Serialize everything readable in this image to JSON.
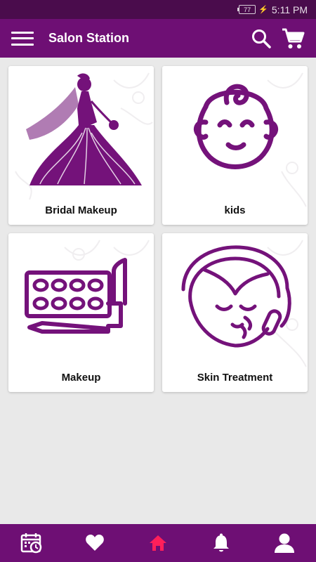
{
  "status_bar": {
    "battery": "77",
    "time": "5:11 PM"
  },
  "app_bar": {
    "title": "Salon Station"
  },
  "categories": [
    {
      "label": "Bridal Makeup",
      "icon": "bride-icon"
    },
    {
      "label": "kids",
      "icon": "baby-face-icon"
    },
    {
      "label": "Makeup",
      "icon": "makeup-kit-icon"
    },
    {
      "label": "Skin Treatment",
      "icon": "facial-treatment-icon"
    }
  ],
  "bottom_nav": [
    {
      "icon": "calendar-clock-icon"
    },
    {
      "icon": "heart-icon"
    },
    {
      "icon": "home-icon",
      "active": true
    },
    {
      "icon": "bell-icon"
    },
    {
      "icon": "user-icon"
    }
  ],
  "colors": {
    "primary": "#6e0f74",
    "status_bar": "#4a0c4c",
    "accent": "#ff1f5a",
    "icon_purple": "#74127a",
    "background": "#e9e9e9"
  }
}
